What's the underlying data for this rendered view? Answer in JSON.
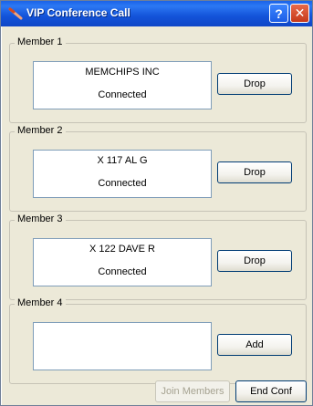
{
  "window": {
    "title": "VIP Conference Call",
    "help_glyph": "?",
    "close_glyph": "✕"
  },
  "members": [
    {
      "label": "Member 1",
      "name": "MEMCHIPS INC",
      "status": "Connected",
      "action": "Drop"
    },
    {
      "label": "Member 2",
      "name": "X 117 AL G",
      "status": "Connected",
      "action": "Drop"
    },
    {
      "label": "Member 3",
      "name": "X 122 DAVE R",
      "status": "Connected",
      "action": "Drop"
    },
    {
      "label": "Member 4",
      "name": "",
      "status": "",
      "action": "Add"
    }
  ],
  "footer": {
    "join_label": "Join Members",
    "join_enabled": false,
    "end_label": "End Conf"
  },
  "colors": {
    "titlebar": "#1353d9",
    "window_bg": "#ece9d8",
    "close_button": "#c6391a"
  }
}
